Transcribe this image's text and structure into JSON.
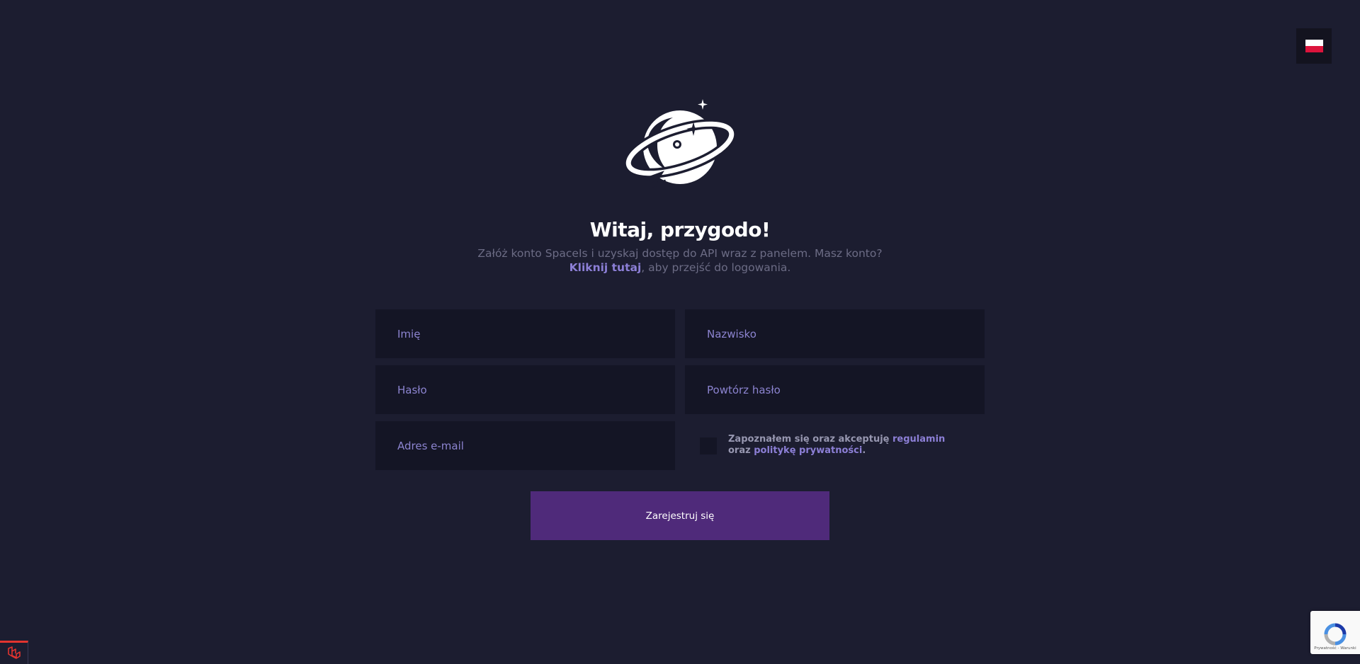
{
  "language": {
    "code": "pl",
    "flag_colors": {
      "top": "#ffffff",
      "bottom": "#dc143c"
    },
    "icon": "flag-pl-icon"
  },
  "logo": {
    "icon": "planet-astronaut-logo"
  },
  "heading": {
    "title": "Witaj, przygodo!",
    "subtitle_line1": "Załóż konto SpaceIs i uzyskaj dostęp do API wraz z panelem. Masz konto?",
    "login_link": "Kliknij tutaj",
    "subtitle_line2_rest": ", aby przejść do logowania."
  },
  "form": {
    "first_name_placeholder": "Imię",
    "last_name_placeholder": "Nazwisko",
    "password_placeholder": "Hasło",
    "repeat_password_placeholder": "Powtórz hasło",
    "email_placeholder": "Adres e-mail",
    "terms": {
      "text_before": "Zapoznałem się oraz akceptuję ",
      "terms_link": "regulamin",
      "text_middle": "oraz ",
      "privacy_link": "politykę prywatności",
      "text_after": "."
    },
    "submit_label": "Zarejestruj się"
  },
  "recaptcha": {
    "links": "Prywatność - Warunki"
  },
  "colors": {
    "background": "#1c1d30",
    "input_bg": "#141525",
    "accent": "#8c7fd6",
    "button": "#4f2a7a"
  }
}
